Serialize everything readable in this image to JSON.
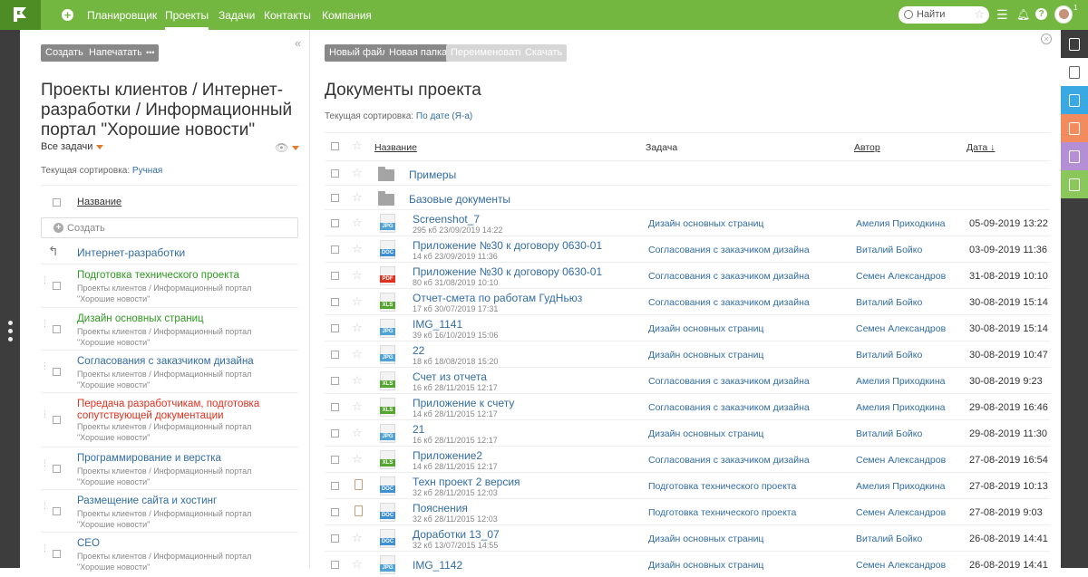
{
  "topbar": {
    "nav": [
      "Планировщик",
      "Проекты",
      "Задачи",
      "Контакты",
      "Компания"
    ],
    "active_nav": "Проекты",
    "search_label": "Найти",
    "badge_count": "1"
  },
  "left": {
    "buttons": {
      "create": "Создать",
      "print": "Напечатать",
      "more": "•••"
    },
    "title": "Проекты клиентов / Интернет-разработки / Информационный портал \"Хорошие новости\"",
    "filter": "Все задачи",
    "sort_label": "Текущая сортировка:",
    "sort_value": "Ручная",
    "col_name": "Название",
    "create_placeholder": "Создать",
    "parent": "Интернет-разработки",
    "tasks": [
      {
        "title": "Подготовка технического проекта",
        "sub": "Проекты клиентов / Информационный портал \"Хорошие новости\"",
        "color": "#2e9a1f"
      },
      {
        "title": "Дизайн основных страниц",
        "sub": "Проекты клиентов / Информационный портал \"Хорошие новости\"",
        "color": "#2e9a1f"
      },
      {
        "title": "Согласования с заказчиком дизайна",
        "sub": "Проекты клиентов / Информационный портал \"Хорошие новости\"",
        "color": "#326da5"
      },
      {
        "title": "Передача разработчикам, подготовка сопутствующей документации",
        "sub": "Проекты клиентов / Информационный портал \"Хорошие новости\"",
        "color": "#e0301e"
      },
      {
        "title": "Программирование и верстка",
        "sub": "Проекты клиентов / Информационный портал \"Хорошие новости\"",
        "color": "#326da5"
      },
      {
        "title": "Размещение сайта и хостинг",
        "sub": "Проекты клиентов / Информационный портал \"Хорошие новости\"",
        "color": "#326da5"
      },
      {
        "title": "СЕО",
        "sub": "Проекты клиентов / Информационный портал \"Хорошие новости\"",
        "color": "#326da5"
      }
    ]
  },
  "main": {
    "buttons": {
      "new_file": "Новый файл",
      "new_folder": "Новая папка",
      "rename": "Переименовать",
      "download": "Скачать"
    },
    "title": "Документы проекта",
    "sort_label": "Текущая сортировка:",
    "sort_value": "По дате (Я-а)",
    "columns": {
      "name": "Название",
      "task": "Задача",
      "author": "Автор",
      "date": "Дата ↓"
    },
    "folders": [
      "Примеры",
      "Базовые документы"
    ],
    "files": [
      {
        "name": "Screenshot_7",
        "meta": "295 кб 23/09/2019 14:22",
        "type": "JPG",
        "task": "Дизайн основных страниц",
        "author": "Амелия Приходкина",
        "date": "05-09-2019 13:22",
        "note": false
      },
      {
        "name": "Приложение №30 к договору 0630-01",
        "meta": "14 кб 23/09/2019 11:36",
        "type": "DOC",
        "task": "Согласования с заказчиком дизайна",
        "author": "Виталий Бойко",
        "date": "03-09-2019 11:36",
        "note": false
      },
      {
        "name": "Приложение №30 к договору 0630-01",
        "meta": "80 кб 31/08/2019 10:10",
        "type": "PDF",
        "task": "Согласования с заказчиком дизайна",
        "author": "Семен Александров",
        "date": "31-08-2019 10:10",
        "note": false
      },
      {
        "name": "Отчет-смета по работам ГудНьюз",
        "meta": "17 кб 30/07/2019 17:31",
        "type": "XLS",
        "task": "Согласования с заказчиком дизайна",
        "author": "Виталий Бойко",
        "date": "30-08-2019 15:14",
        "note": false
      },
      {
        "name": "IMG_1141",
        "meta": "39 кб 16/10/2019 15:06",
        "type": "JPG",
        "task": "Дизайн основных страниц",
        "author": "Семен Александров",
        "date": "30-08-2019 15:14",
        "note": false
      },
      {
        "name": "22",
        "meta": "18 кб 18/08/2018 15:20",
        "type": "JPG",
        "task": "Дизайн основных страниц",
        "author": "Виталий Бойко",
        "date": "30-08-2019 10:47",
        "note": false
      },
      {
        "name": "Счет из отчета",
        "meta": "16 кб 28/11/2015 12:17",
        "type": "XLS",
        "task": "Согласования с заказчиком дизайна",
        "author": "Амелия Приходкина",
        "date": "30-08-2019 9:23",
        "note": false
      },
      {
        "name": "Приложение к счету",
        "meta": "14 кб 28/11/2015 12:17",
        "type": "XLS",
        "task": "Согласования с заказчиком дизайна",
        "author": "Амелия Приходкина",
        "date": "29-08-2019 16:46",
        "note": false
      },
      {
        "name": "21",
        "meta": "16 кб 28/11/2015 12:17",
        "type": "JPG",
        "task": "Дизайн основных страниц",
        "author": "Виталий Бойко",
        "date": "29-08-2019 11:30",
        "note": false
      },
      {
        "name": "Приложение2",
        "meta": "14 кб 28/11/2015 12:17",
        "type": "XLS",
        "task": "Согласования с заказчиком дизайна",
        "author": "Семен Александров",
        "date": "27-08-2019 16:54",
        "note": false
      },
      {
        "name": "Техн проект 2 версия",
        "meta": "32 кб 28/11/2015 12:03",
        "type": "DOC",
        "task": "Подготовка технического проекта",
        "author": "Амелия Приходкина",
        "date": "27-08-2019 10:13",
        "note": true
      },
      {
        "name": "Пояснения",
        "meta": "32 кб 28/11/2015 12:03",
        "type": "DOC",
        "task": "Подготовка технического проекта",
        "author": "Семен Александров",
        "date": "27-08-2019 9:03",
        "note": true
      },
      {
        "name": "Доработки 13_07",
        "meta": "32 кб 13/07/2015 14:55",
        "type": "DOC",
        "task": "Дизайн основных страниц",
        "author": "Виталий Бойко",
        "date": "26-08-2019 14:41",
        "note": false
      },
      {
        "name": "IMG_1142",
        "meta": "",
        "type": "JPG",
        "task": "Дизайн основных страниц",
        "author": "Семен Александров",
        "date": "26-08-2019 14:41",
        "note": false
      }
    ]
  },
  "file_type_colors": {
    "JPG": "#4fa3d8",
    "DOC": "#3f8fd4",
    "PDF": "#e0301e",
    "XLS": "#55a531"
  },
  "right_tab_colors": [
    "#3d3d3d",
    "#3d3d3d",
    "#3aa8e3",
    "#f28b5d",
    "#b58fd6",
    "#8ac85c"
  ]
}
